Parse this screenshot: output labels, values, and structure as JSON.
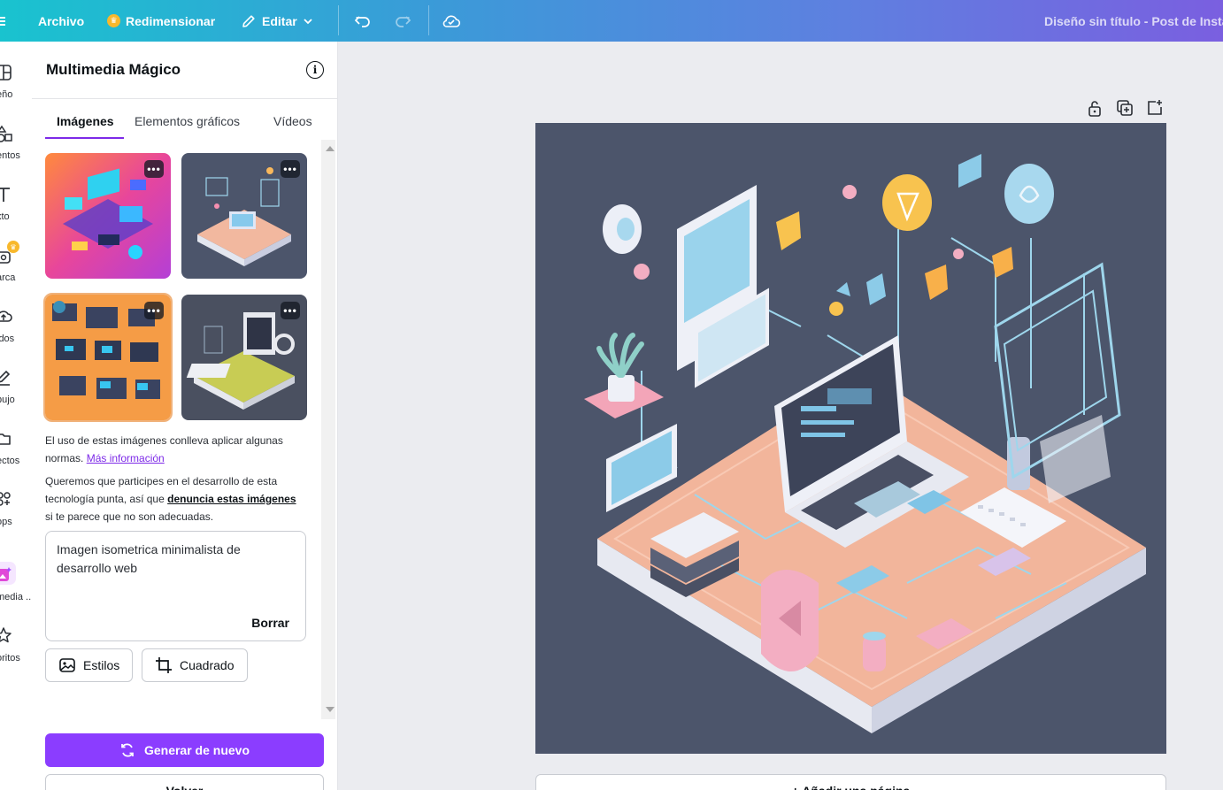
{
  "topbar": {
    "menu_icon": "hamburger-icon",
    "file_label": "Archivo",
    "resize_label": "Redimensionar",
    "edit_label": "Editar",
    "document_title": "Diseño sin título - Post de Insta"
  },
  "rail": {
    "items": [
      {
        "label": "eño",
        "icon": "layout-icon"
      },
      {
        "label": "entos",
        "icon": "shapes-icon"
      },
      {
        "label": "xto",
        "icon": "text-icon"
      },
      {
        "label": "arca",
        "icon": "brand-icon"
      },
      {
        "label": "idos",
        "icon": "upload-icon"
      },
      {
        "label": "bujo",
        "icon": "draw-icon"
      },
      {
        "label": "ectos",
        "icon": "folder-icon"
      },
      {
        "label": "ops",
        "icon": "apps-icon"
      },
      {
        "label": "media ...",
        "icon": "magic-media-icon"
      },
      {
        "label": "oritos",
        "icon": "star-icon"
      }
    ]
  },
  "panel": {
    "title": "Multimedia Mágico",
    "tabs": [
      "Imágenes",
      "Elementos gráficos",
      "Vídeos"
    ],
    "active_tab": "Imágenes",
    "more_label": "•••",
    "notice_1": "El uso de estas imágenes conlleva aplicar algunas normas.",
    "notice_1_link": "Más información",
    "notice_2_pre": "Queremos que participes en el desarrollo de esta tecnología punta, así que",
    "notice_2_link": "denuncia estas imágenes",
    "notice_2_post": "si te parece que no son adecuadas.",
    "prompt": "Imagen isometrica minimalista de desarrollo web",
    "clear_label": "Borrar",
    "styles_label": "Estilos",
    "aspect_label": "Cuadrado",
    "regenerate_label": "Generar de nuevo",
    "back_label": "Volver"
  },
  "canvas": {
    "add_page_label": "+ Añadir una página"
  },
  "colors": {
    "accent": "#8b3dff",
    "tab_underline": "#7d2ae8",
    "artboard_bg": "#4c556b"
  }
}
